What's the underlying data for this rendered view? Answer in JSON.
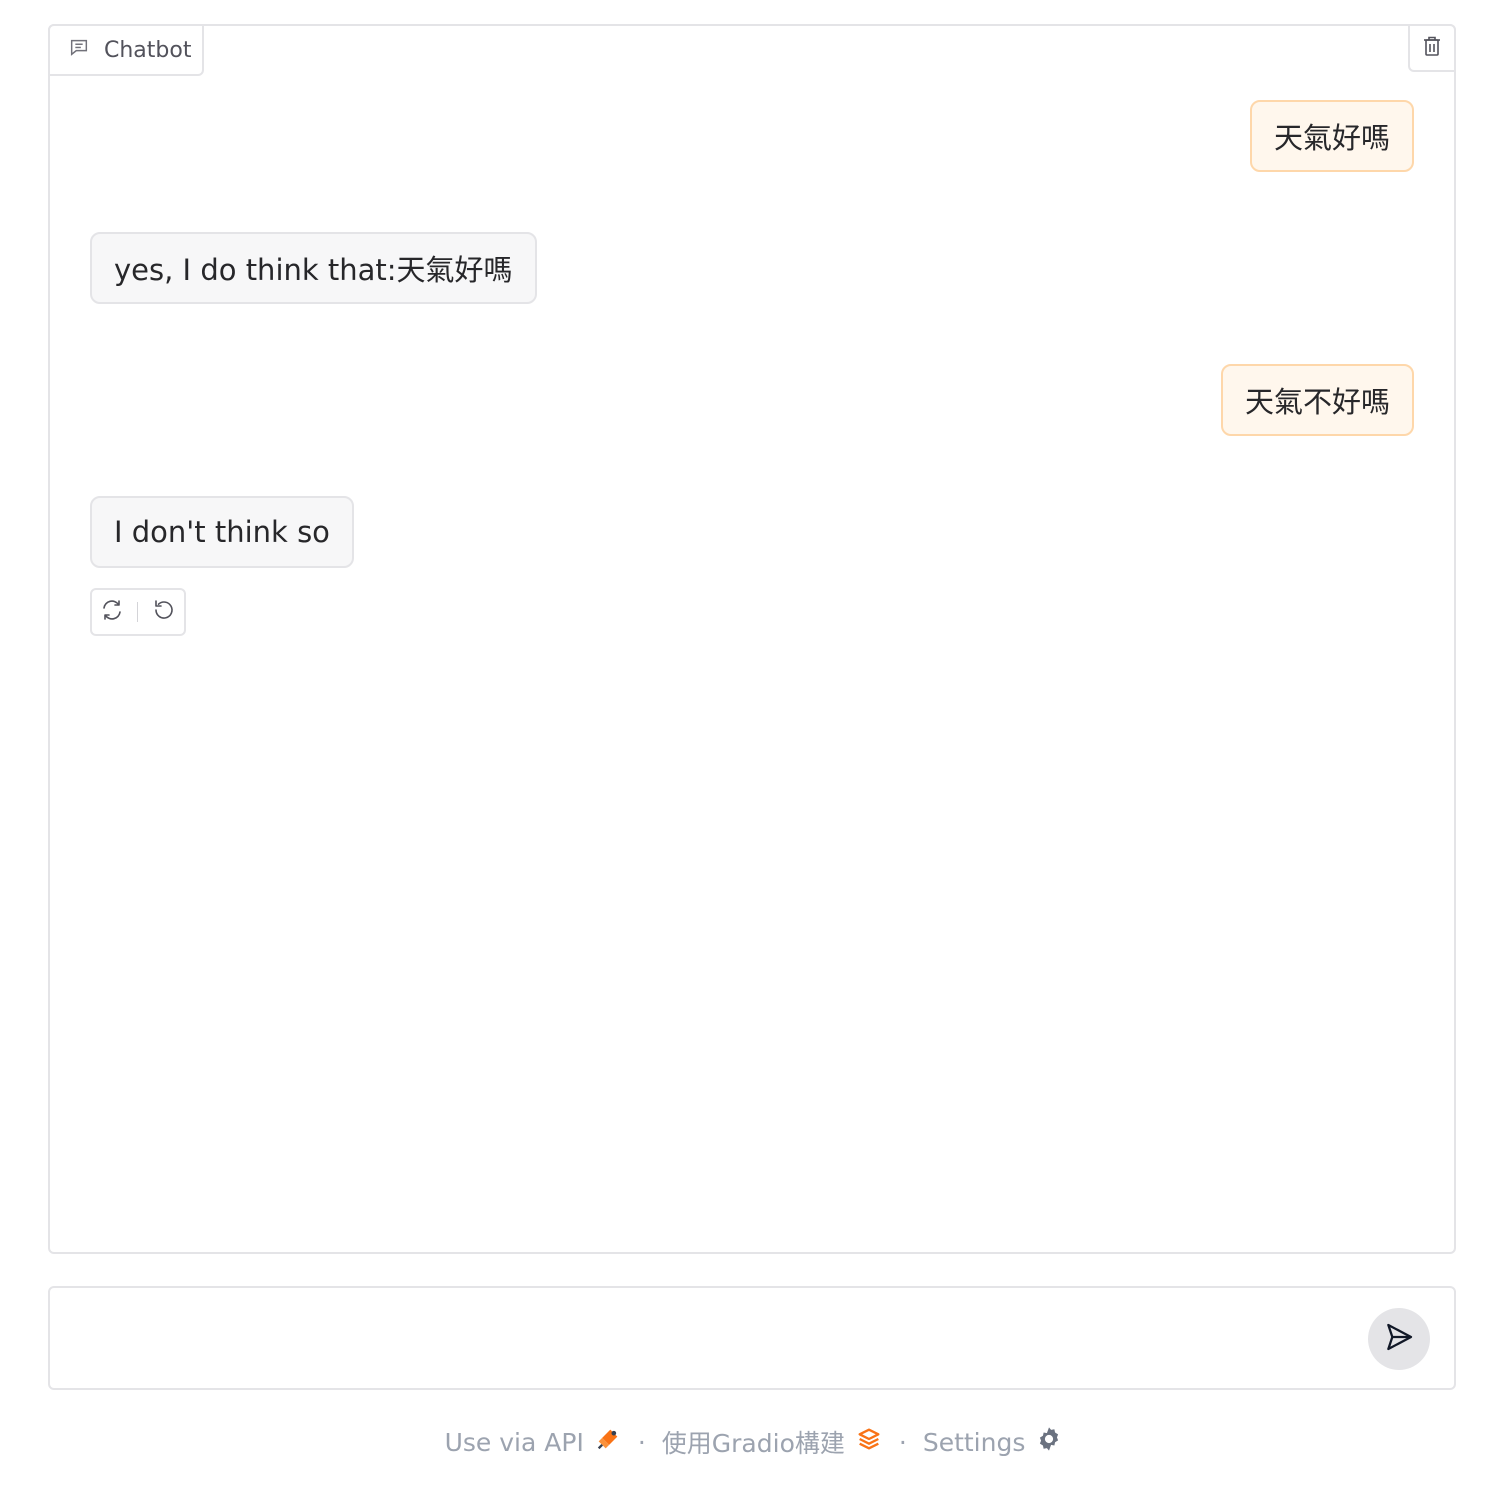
{
  "chatbot": {
    "label": "Chatbot",
    "messages": [
      {
        "role": "user",
        "text": "天氣好嗎"
      },
      {
        "role": "bot",
        "text": "yes, I do think that:天氣好嗎"
      },
      {
        "role": "user",
        "text": "天氣不好嗎"
      },
      {
        "role": "bot",
        "text": "I don't think so"
      }
    ],
    "icons": {
      "label": "chat-icon",
      "clear": "trash-icon",
      "retry": "retry-icon",
      "undo": "undo-icon"
    }
  },
  "input": {
    "placeholder": "",
    "value": "",
    "send_icon": "send-icon"
  },
  "footer": {
    "api_label": "Use via API",
    "built_with": "使用Gradio構建",
    "separator": "·",
    "settings": "Settings"
  },
  "colors": {
    "user_bubble_bg": "#fff7ed",
    "user_bubble_border": "#fed7aa",
    "bot_bubble_bg": "#f7f7f8",
    "accent": "#f97316"
  }
}
